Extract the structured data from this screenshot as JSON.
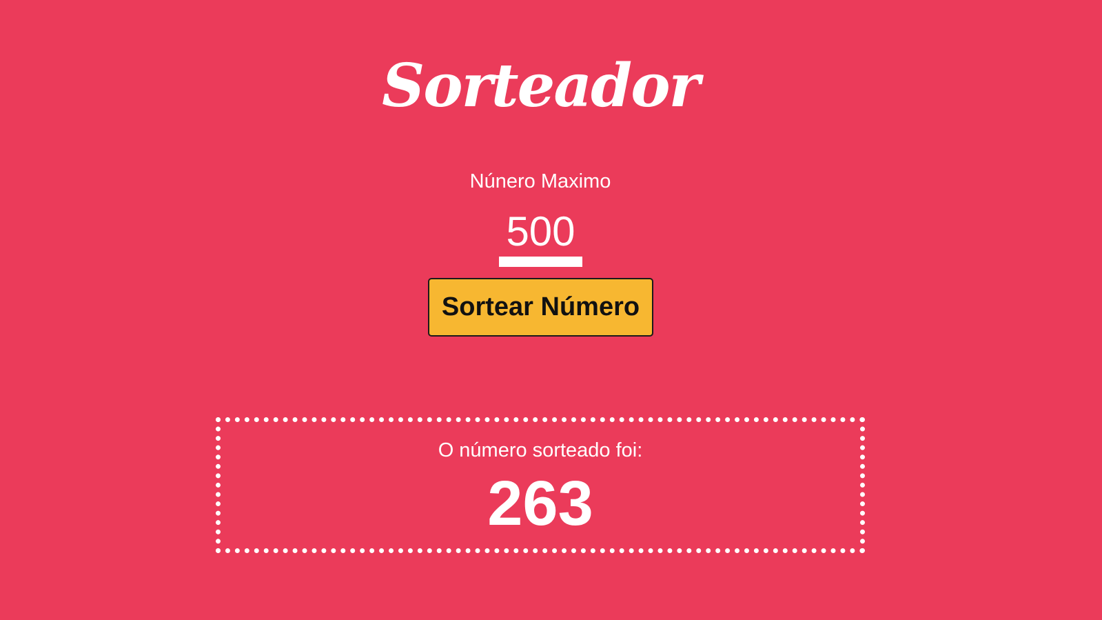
{
  "header": {
    "title": "Sorteador"
  },
  "form": {
    "max_label": "Núnero Maximo",
    "max_value": "500",
    "draw_button_label": "Sortear Número"
  },
  "result": {
    "label": "O número sorteado foi:",
    "number": "263"
  },
  "colors": {
    "background": "#eb3b5a",
    "button": "#f7b731",
    "text": "#ffffff"
  }
}
